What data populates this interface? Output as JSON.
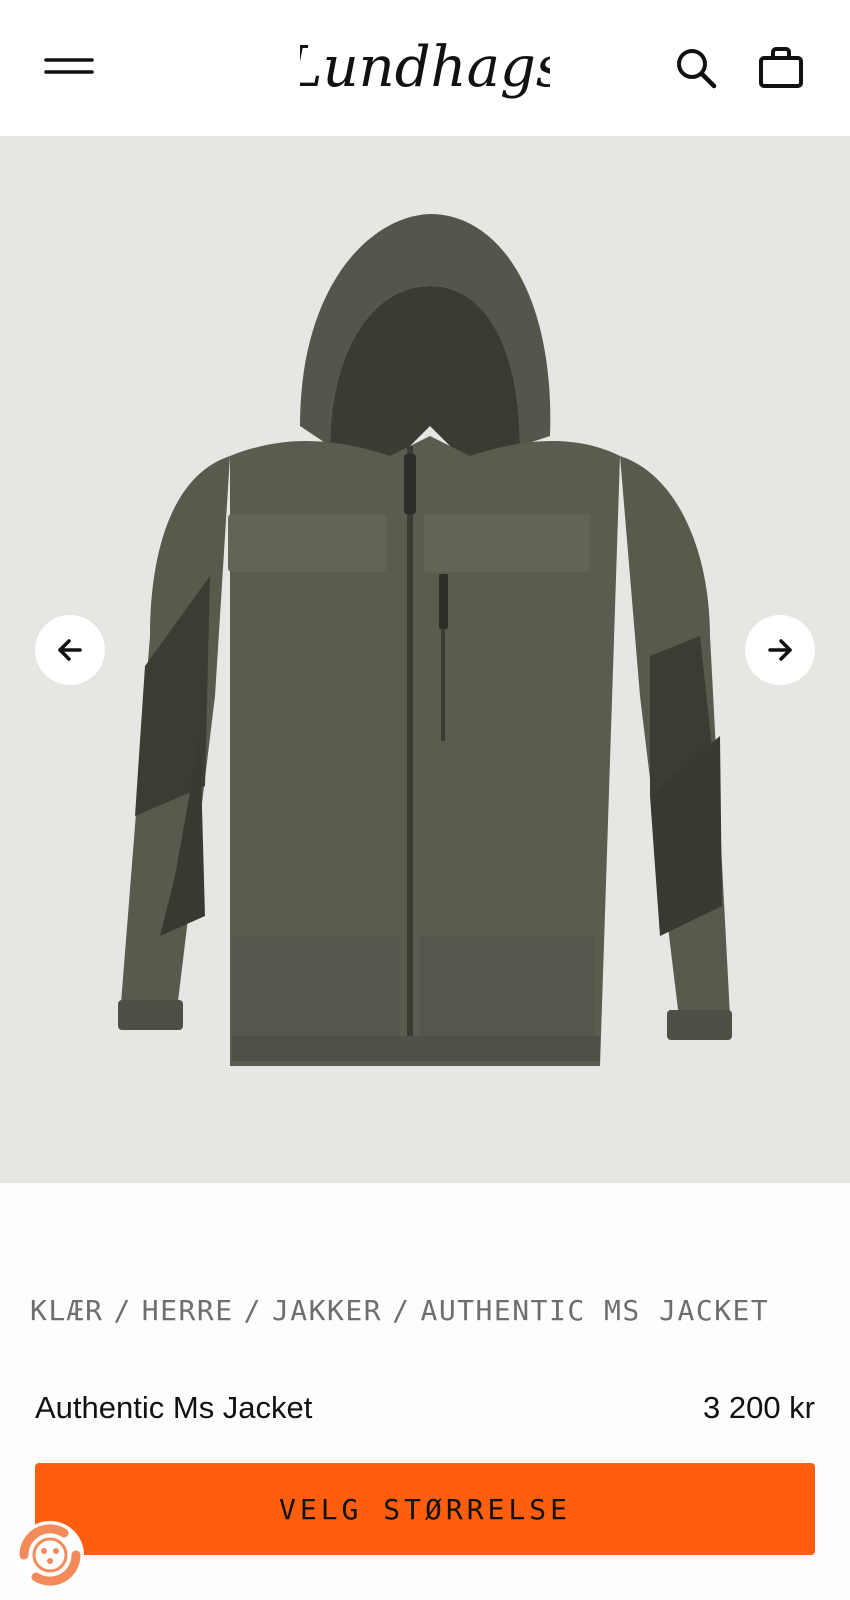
{
  "header": {
    "logo_text": "Lundhags",
    "menu_icon": "hamburger-menu-icon",
    "search_icon": "search-icon",
    "bag_icon": "shopping-bag-icon"
  },
  "gallery": {
    "prev_icon": "arrow-left-icon",
    "next_icon": "arrow-right-icon",
    "image_subject": "olive green hooded jacket"
  },
  "breadcrumb": [
    "KLÆR",
    "HERRE",
    "JAKKER",
    "AUTHENTIC MS JACKET"
  ],
  "breadcrumb_separator": "/",
  "product": {
    "title": "Authentic Ms Jacket",
    "price": "3 200 kr"
  },
  "cta": {
    "label": "VELG STØRRELSE"
  },
  "colors": {
    "accent": "#ff5e0e",
    "gallery_bg": "#e7e6e3",
    "jacket": "#5b5c50",
    "jacket_dark": "#393b32"
  }
}
